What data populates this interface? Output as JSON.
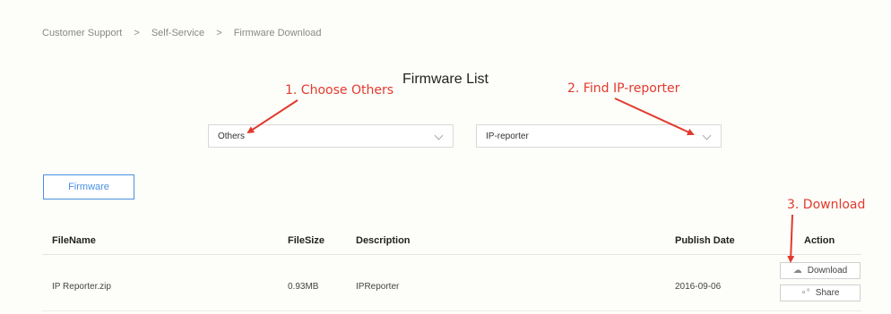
{
  "breadcrumb": {
    "items": [
      "Customer Support",
      ">",
      "Self-Service",
      ">",
      "Firmware Download"
    ]
  },
  "page": {
    "title": "Firmware List"
  },
  "filters": {
    "category": {
      "value": "Others"
    },
    "product": {
      "value": "IP-reporter"
    }
  },
  "tab": {
    "label": "Firmware"
  },
  "annotations": {
    "step1": "1. Choose Others",
    "step2": "2. Find IP-reporter",
    "step3": "3. Download"
  },
  "table": {
    "headers": [
      "FileName",
      "FileSize",
      "Description",
      "Publish Date",
      "Action"
    ],
    "rows": [
      {
        "filename": "IP Reporter.zip",
        "filesize": "0.93MB",
        "description": "IPReporter",
        "publish_date": "2016-09-06",
        "download_label": "Download",
        "share_label": "Share"
      }
    ]
  },
  "colors": {
    "accent": "#4a90e2",
    "annotation": "#e23a2e"
  },
  "icons": {
    "download": "cloud-download-icon",
    "share": "share-icon",
    "dropdown": "chevron-down-icon"
  }
}
